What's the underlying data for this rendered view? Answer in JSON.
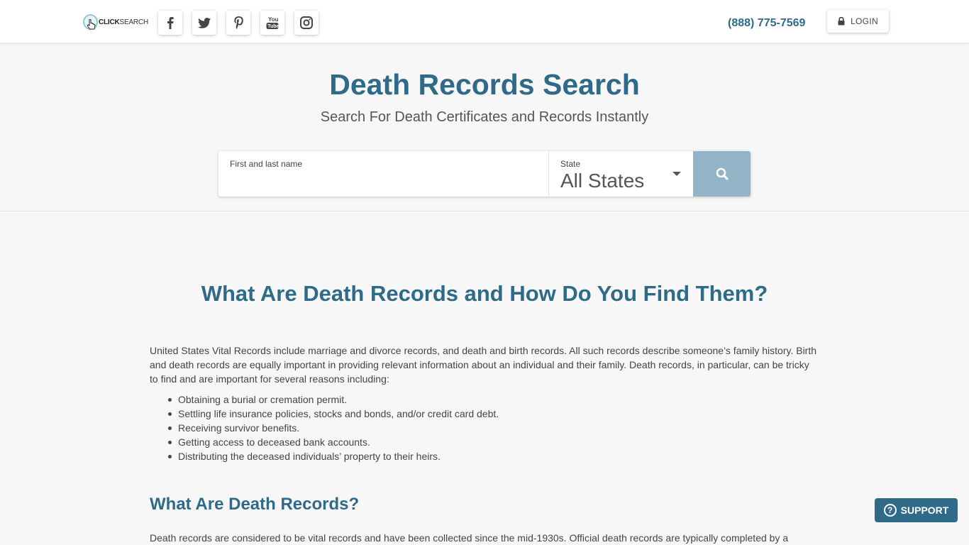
{
  "header": {
    "logo_bold": "CLICK",
    "logo_light": "SEARCH",
    "social": [
      {
        "name": "facebook-icon"
      },
      {
        "name": "twitter-icon"
      },
      {
        "name": "pinterest-icon"
      },
      {
        "name": "youtube-icon"
      },
      {
        "name": "instagram-icon"
      }
    ],
    "phone": "(888) 775-7569",
    "login_label": "LOGIN"
  },
  "hero": {
    "title": "Death Records Search",
    "subtitle": "Search For Death Certificates and Records Instantly",
    "name_label": "First and last name",
    "name_value": "",
    "state_label": "State",
    "state_value": "All States"
  },
  "content": {
    "title": "What Are Death Records and How Do You Find Them?",
    "intro": "United States Vital Records include marriage and divorce records, and death and birth records. All such records describe someone’s family history. Birth and death records are equally important in providing relevant information about an individual and their family. Death records, in particular, can be tricky to find and are important for several reasons including:",
    "bullets": [
      "Obtaining a burial or cremation permit.",
      "Settling life insurance policies, stocks and bonds, and/or credit card debt.",
      "Receiving survivor benefits.",
      "Getting access to deceased bank accounts.",
      "Distributing the deceased individuals’ property to their heirs."
    ],
    "subtitle": "What Are Death Records?",
    "para2": "Death records are considered to be vital records and have been collected since the mid-1930s. Official death records are typically completed by a"
  },
  "support_label": "SUPPORT",
  "colors": {
    "brand": "#2f6b89",
    "search_button": "#93b4c6",
    "background": "#f7f7f7"
  }
}
